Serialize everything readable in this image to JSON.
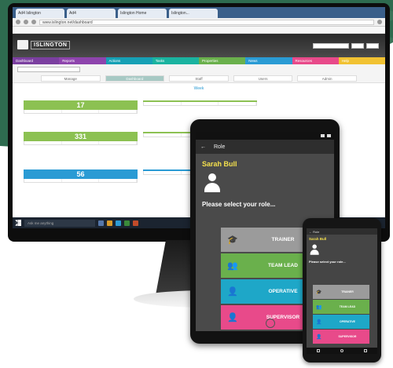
{
  "colors": {
    "trainer": "#9b9b9b",
    "team_lead": "#6ab04c",
    "operative": "#1ea7c8",
    "supervisor": "#e84a8a",
    "accent_yellow": "#f4e04d"
  },
  "browser": {
    "tabs": [
      "Ad4 Islington",
      "Ad4",
      "Islington Home",
      "Islington..."
    ],
    "url": "www.islington.net/dashboard"
  },
  "app": {
    "logo_text": "ISLINGTON",
    "nav": [
      {
        "label": "Dashboard",
        "color": "#7b3fa0"
      },
      {
        "label": "Reports",
        "color": "#8e44ad"
      },
      {
        "label": "Actions",
        "color": "#16a0b5"
      },
      {
        "label": "Tasks",
        "color": "#1ab3a0"
      },
      {
        "label": "Properties",
        "color": "#6ab04c"
      },
      {
        "label": "News",
        "color": "#2a9bd4"
      },
      {
        "label": "Resources",
        "color": "#e84a8a"
      },
      {
        "label": "Help",
        "color": "#f1c232"
      }
    ],
    "tabs": [
      "Manage",
      "Dashboard",
      "Staff",
      "Users",
      "Admin"
    ],
    "active_tab": "Dashboard",
    "date_head": "Week",
    "tiles": [
      {
        "value": "17",
        "color": "#8cc152"
      },
      {
        "value": "",
        "color": "#8cc152"
      },
      {
        "value": "331",
        "color": "#8cc152"
      },
      {
        "value": "",
        "color": "#8cc152"
      },
      {
        "value": "56",
        "color": "#2a9bd4"
      },
      {
        "value": "",
        "color": "#2a9bd4"
      }
    ]
  },
  "taskbar": {
    "search": "Ask me anything"
  },
  "mobile": {
    "title": "Role",
    "user_name": "Sarah Bull",
    "prompt": "Please select your role...",
    "roles": [
      {
        "label": "TRAINER",
        "icon": "graduation-cap-icon",
        "glyph": "🎓"
      },
      {
        "label": "TEAM LEAD",
        "icon": "team-icon",
        "glyph": "👥"
      },
      {
        "label": "OPERATIVE",
        "icon": "person-outline-icon",
        "glyph": "👤"
      },
      {
        "label": "SUPERVISOR",
        "icon": "person-icon",
        "glyph": "👤"
      }
    ]
  }
}
